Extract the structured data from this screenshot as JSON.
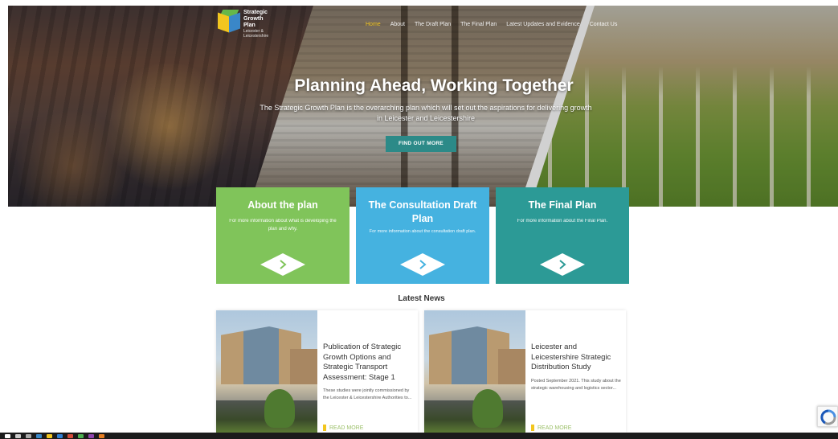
{
  "header": {
    "logo": {
      "line1": "Strategic",
      "line2": "Growth",
      "line3": "Plan",
      "line4": "Leicester &",
      "line5": "Leicestershire"
    },
    "nav": [
      {
        "label": "Home",
        "active": true
      },
      {
        "label": "About",
        "active": false
      },
      {
        "label": "The Draft Plan",
        "active": false
      },
      {
        "label": "The Final Plan",
        "active": false
      },
      {
        "label": "Latest Updates and Evidence",
        "active": false
      },
      {
        "label": "Contact Us",
        "active": false
      }
    ]
  },
  "hero": {
    "title": "Planning Ahead, Working Together",
    "subtitle": "The Strategic Growth Plan is the overarching plan which will set out the aspirations for delivering growth in Leicester and Leicestershire",
    "button_label": "FIND OUT MORE"
  },
  "cards": [
    {
      "title": "About the plan",
      "text": "For more information about what is developing the plan and why."
    },
    {
      "title": "The Consultation Draft Plan",
      "text": "For more information about the consultation draft plan."
    },
    {
      "title": "The Final Plan",
      "text": "For more information about the Final Plan."
    }
  ],
  "news": {
    "heading": "Latest News",
    "items": [
      {
        "title": "Publication of Strategic Growth Options and Strategic Transport Assessment: Stage 1",
        "excerpt": "These studies were jointly commissioned by the Leicester & Leicestershire Authorities to...",
        "read_more": "READ MORE"
      },
      {
        "title": "Leicester and Leicestershire Strategic Distribution Study",
        "excerpt": "Posted September 2021. This study about the strategic warehousing and logistics sector...",
        "read_more": "READ MORE"
      }
    ]
  },
  "colors": {
    "accent_yellow": "#f2c61f",
    "card_green": "#80c45a",
    "card_blue": "#45b2e0",
    "card_teal": "#2c9a96",
    "button_teal": "#2c8a88"
  }
}
